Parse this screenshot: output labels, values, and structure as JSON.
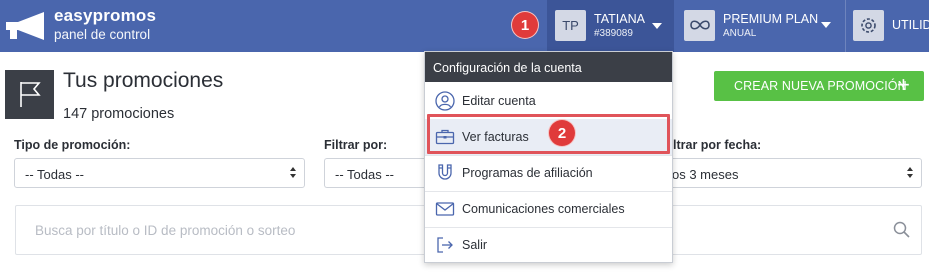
{
  "header": {
    "brand_name": "easypromos",
    "brand_sub": "panel de control",
    "user": {
      "initials": "TP",
      "name": "TATIANA",
      "id": "#389089"
    },
    "plan": {
      "name": "PREMIUM PLAN",
      "sub": "ANUAL"
    },
    "utilities_label": "UTILID"
  },
  "steps": {
    "first": "1",
    "second": "2"
  },
  "main": {
    "title": "Tus promociones",
    "count": "147 promociones",
    "create_button": "CREAR NUEVA PROMOCIÓN",
    "create_plus": "+"
  },
  "filters": {
    "type": {
      "label": "Tipo de promoción:",
      "value": "-- Todas --"
    },
    "filter": {
      "label": "Filtrar por:",
      "value": "-- Todas --"
    },
    "date": {
      "label": "ltrar por fecha:",
      "value": "os 3 meses"
    }
  },
  "search": {
    "placeholder": "Busca por título o ID de promoción o sorteo"
  },
  "dropdown": {
    "header": "Configuración de la cuenta",
    "items": [
      {
        "label": "Editar cuenta",
        "icon": "user-icon"
      },
      {
        "label": "Ver facturas",
        "icon": "briefcase-icon"
      },
      {
        "label": "Programas de afiliación",
        "icon": "magnet-icon"
      },
      {
        "label": "Comunicaciones comerciales",
        "icon": "envelope-icon"
      },
      {
        "label": "Salir",
        "icon": "logout-icon"
      }
    ]
  },
  "colors": {
    "topbar": "#4a66ad",
    "user_menu": "#3c5598",
    "create_button": "#58c145",
    "step_badge": "#e03b3b",
    "highlight": "#e0545a",
    "dark_panel": "#3b3f47"
  }
}
